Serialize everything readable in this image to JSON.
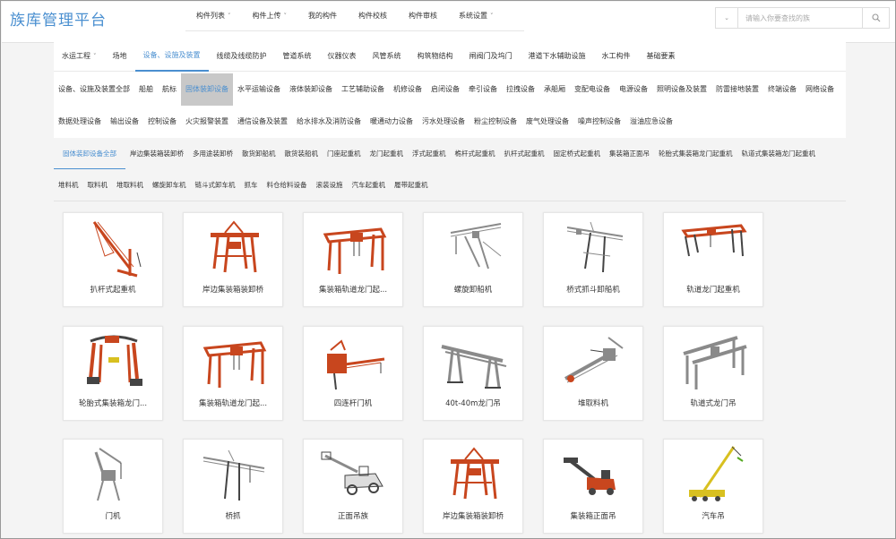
{
  "header": {
    "logo": "族库管理平台",
    "nav": [
      {
        "label": "构件列表",
        "dropdown": true
      },
      {
        "label": "构件上传",
        "dropdown": true
      },
      {
        "label": "我的构件",
        "dropdown": false
      },
      {
        "label": "构件校核",
        "dropdown": false
      },
      {
        "label": "构件审核",
        "dropdown": false
      },
      {
        "label": "系统设置",
        "dropdown": true
      }
    ],
    "search": {
      "placeholder": "请输入你要查找的族"
    }
  },
  "categories": {
    "level1": [
      "水运工程",
      "场地",
      "设备、设施及装置",
      "线缆及线缆防护",
      "管道系统",
      "仪器仪表",
      "风管系统",
      "构筑物结构",
      "闸阀门及坞门",
      "港道下水辅助设施",
      "水工构件",
      "基础要素"
    ],
    "level1_active": 2,
    "level2": [
      "设备、设施及装置全部",
      "船舶",
      "航标",
      "固体装卸设备",
      "水平运输设备",
      "液体装卸设备",
      "工艺辅助设备",
      "机修设备",
      "启闭设备",
      "牵引设备",
      "拉拽设备",
      "承船厢",
      "变配电设备",
      "电源设备",
      "照明设备及装置",
      "防雷接地装置",
      "终端设备",
      "网络设备",
      "数据处理设备",
      "输出设备",
      "控制设备",
      "火灾报警装置",
      "通信设备及装置",
      "给水排水及消防设备",
      "暖通动力设备",
      "污水处理设备",
      "粉尘控制设备",
      "废气处理设备",
      "噪声控制设备",
      "溢油应急设备"
    ],
    "level2_active": 3,
    "level3": [
      "固体装卸设备全部",
      "岸边集装箱装卸桥",
      "多用途装卸桥",
      "散货卸船机",
      "散货装船机",
      "门座起重机",
      "龙门起重机",
      "浮式起重机",
      "桅杆式起重机",
      "扒杆式起重机",
      "固定桥式起重机",
      "集装箱正面吊",
      "轮胎式集装箱龙门起重机",
      "轨道式集装箱龙门起重机",
      "堆料机",
      "取料机",
      "堆取料机",
      "螺旋卸车机",
      "链斗式卸车机",
      "抓车",
      "料仓给料设备",
      "滚装设施",
      "汽车起重机",
      "履带起重机"
    ],
    "level3_active": 0
  },
  "cards": [
    {
      "label": "扒杆式起重机",
      "icon": "boom-crane-icon"
    },
    {
      "label": "岸边集装箱装卸桥",
      "icon": "quay-crane-icon"
    },
    {
      "label": "集装箱轨道龙门起...",
      "icon": "gantry-crane-icon"
    },
    {
      "label": "螺旋卸船机",
      "icon": "screw-unloader-icon"
    },
    {
      "label": "桥式抓斗卸船机",
      "icon": "grab-unloader-icon"
    },
    {
      "label": "轨道龙门起重机",
      "icon": "rail-gantry-icon"
    },
    {
      "label": "轮胎式集装箱龙门...",
      "icon": "rtg-crane-icon"
    },
    {
      "label": "集装箱轨道龙门起...",
      "icon": "gantry-crane-icon"
    },
    {
      "label": "四连杆门机",
      "icon": "four-link-crane-icon"
    },
    {
      "label": "40t-40m龙门吊",
      "icon": "gantry-frame-icon"
    },
    {
      "label": "堆取料机",
      "icon": "stacker-reclaimer-icon"
    },
    {
      "label": "轨道式龙门吊",
      "icon": "rail-gantry-frame-icon"
    },
    {
      "label": "门机",
      "icon": "portal-crane-icon"
    },
    {
      "label": "桥抓",
      "icon": "bridge-grab-icon"
    },
    {
      "label": "正面吊族",
      "icon": "reach-stacker-icon"
    },
    {
      "label": "岸边集装箱装卸桥",
      "icon": "quay-crane-icon"
    },
    {
      "label": "集装箱正面吊",
      "icon": "reach-stacker-red-icon"
    },
    {
      "label": "汽车吊",
      "icon": "truck-crane-icon"
    }
  ],
  "colors": {
    "accent": "#4a8fd0",
    "crane_red": "#c8461e",
    "steel": "#8a8a8a",
    "yellow": "#d8c020"
  }
}
